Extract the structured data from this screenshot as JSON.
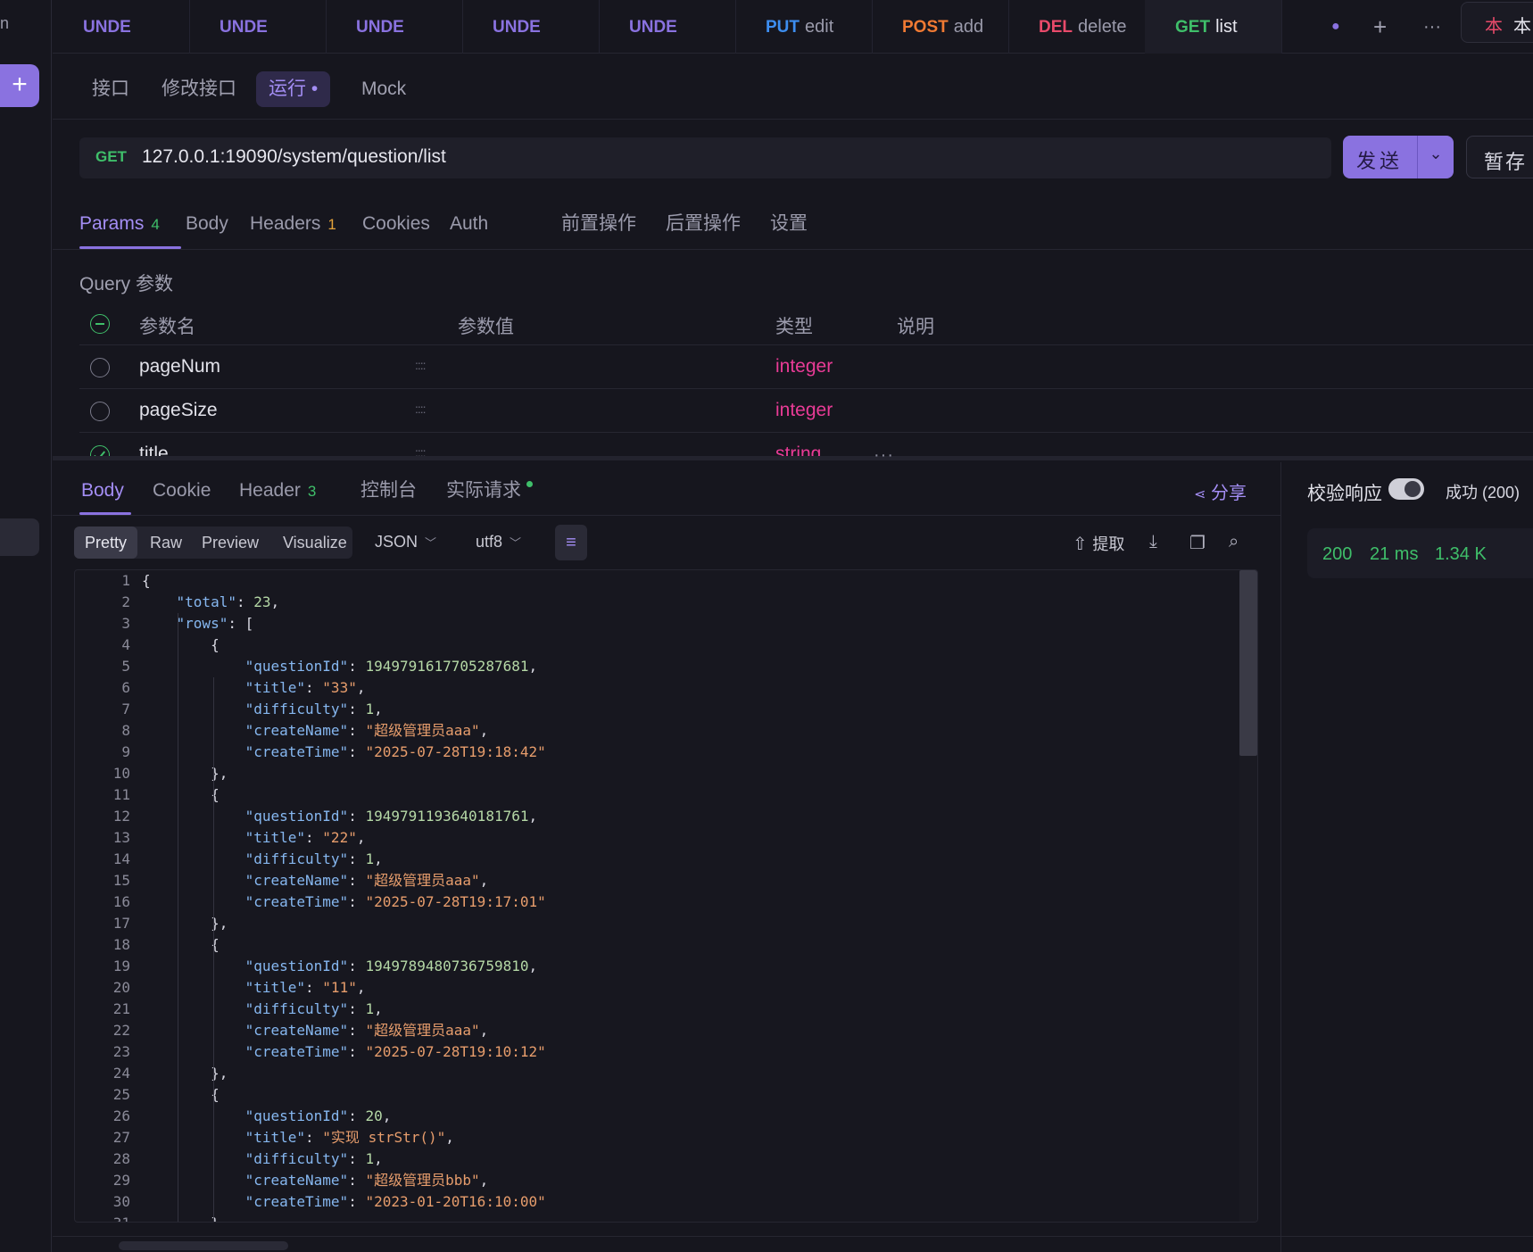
{
  "sidebar": {
    "stub_text": "n",
    "plus_label": "+"
  },
  "tabs": [
    {
      "method": "UNDE",
      "name": "",
      "color": "#8a72e0"
    },
    {
      "method": "UNDE",
      "name": "",
      "color": "#8a72e0"
    },
    {
      "method": "UNDE",
      "name": "",
      "color": "#8a72e0"
    },
    {
      "method": "UNDE",
      "name": "",
      "color": "#8a72e0"
    },
    {
      "method": "UNDE",
      "name": "",
      "color": "#8a72e0"
    },
    {
      "method": "PUT",
      "name": "edit",
      "color": "#3d8ef0"
    },
    {
      "method": "POST",
      "name": "add",
      "color": "#f07a33"
    },
    {
      "method": "DEL",
      "name": "delete",
      "color": "#e84a6a"
    },
    {
      "method": "GET",
      "name": "list",
      "color": "#3fbf6a",
      "active": true
    }
  ],
  "tabbar": {
    "dot": "●",
    "new_tab": "+",
    "more": "···"
  },
  "env": {
    "label1": "本",
    "label2": "本"
  },
  "subtabs": [
    "接口",
    "修改接口",
    "运行",
    "Mock"
  ],
  "subtab_active_suffix": "•",
  "request": {
    "method": "GET",
    "url": "127.0.0.1:19090/system/question/list",
    "send_label": "发送",
    "dropdown_icon": "⌄",
    "save_label": "暂存"
  },
  "request_tabs": [
    {
      "label": "Params",
      "count": "4",
      "count_color": "g"
    },
    {
      "label": "Body"
    },
    {
      "label": "Headers",
      "count": "1",
      "count_color": "o"
    },
    {
      "label": "Cookies"
    },
    {
      "label": "Auth"
    },
    {
      "label": "前置操作"
    },
    {
      "label": "后置操作"
    },
    {
      "label": "设置"
    }
  ],
  "query_label": "Query 参数",
  "params": {
    "headers": {
      "name": "参数名",
      "value": "参数值",
      "type": "类型",
      "desc": "说明"
    },
    "rows": [
      {
        "name": "pageNum",
        "type": "integer",
        "checked": false
      },
      {
        "name": "pageSize",
        "type": "integer",
        "checked": false
      },
      {
        "name": "title",
        "type": "string",
        "checked": true
      }
    ]
  },
  "splitter_dots": "···",
  "response_tabs": [
    {
      "label": "Body"
    },
    {
      "label": "Cookie"
    },
    {
      "label": "Header",
      "count": "3"
    },
    {
      "label": "控制台"
    },
    {
      "label": "实际请求",
      "dot": true
    }
  ],
  "share_label": "分享",
  "validate_label": "校验响应",
  "success_label": "成功 (200)",
  "stats": {
    "status": "200",
    "time": "21 ms",
    "size": "1.34 K"
  },
  "view_modes": [
    "Pretty",
    "Raw",
    "Preview",
    "Visualize"
  ],
  "format": "JSON",
  "encoding": "utf8",
  "extract_label": "提取",
  "code_lines": [
    [
      [
        "p",
        "{"
      ]
    ],
    [
      [
        "p",
        "    "
      ],
      [
        "k",
        "\"total\""
      ],
      [
        "p",
        ": "
      ],
      [
        "num",
        "23"
      ],
      [
        "p",
        ","
      ]
    ],
    [
      [
        "p",
        "    "
      ],
      [
        "k",
        "\"rows\""
      ],
      [
        "p",
        ": ["
      ]
    ],
    [
      [
        "p",
        "        {"
      ]
    ],
    [
      [
        "p",
        "            "
      ],
      [
        "k",
        "\"questionId\""
      ],
      [
        "p",
        ": "
      ],
      [
        "num",
        "1949791617705287681"
      ],
      [
        "p",
        ","
      ]
    ],
    [
      [
        "p",
        "            "
      ],
      [
        "k",
        "\"title\""
      ],
      [
        "p",
        ": "
      ],
      [
        "s",
        "\"33\""
      ],
      [
        "p",
        ","
      ]
    ],
    [
      [
        "p",
        "            "
      ],
      [
        "k",
        "\"difficulty\""
      ],
      [
        "p",
        ": "
      ],
      [
        "num",
        "1"
      ],
      [
        "p",
        ","
      ]
    ],
    [
      [
        "p",
        "            "
      ],
      [
        "k",
        "\"createName\""
      ],
      [
        "p",
        ": "
      ],
      [
        "s",
        "\"超级管理员aaa\""
      ],
      [
        "p",
        ","
      ]
    ],
    [
      [
        "p",
        "            "
      ],
      [
        "k",
        "\"createTime\""
      ],
      [
        "p",
        ": "
      ],
      [
        "s",
        "\"2025-07-28T19:18:42\""
      ]
    ],
    [
      [
        "p",
        "        },"
      ]
    ],
    [
      [
        "p",
        "        {"
      ]
    ],
    [
      [
        "p",
        "            "
      ],
      [
        "k",
        "\"questionId\""
      ],
      [
        "p",
        ": "
      ],
      [
        "num",
        "1949791193640181761"
      ],
      [
        "p",
        ","
      ]
    ],
    [
      [
        "p",
        "            "
      ],
      [
        "k",
        "\"title\""
      ],
      [
        "p",
        ": "
      ],
      [
        "s",
        "\"22\""
      ],
      [
        "p",
        ","
      ]
    ],
    [
      [
        "p",
        "            "
      ],
      [
        "k",
        "\"difficulty\""
      ],
      [
        "p",
        ": "
      ],
      [
        "num",
        "1"
      ],
      [
        "p",
        ","
      ]
    ],
    [
      [
        "p",
        "            "
      ],
      [
        "k",
        "\"createName\""
      ],
      [
        "p",
        ": "
      ],
      [
        "s",
        "\"超级管理员aaa\""
      ],
      [
        "p",
        ","
      ]
    ],
    [
      [
        "p",
        "            "
      ],
      [
        "k",
        "\"createTime\""
      ],
      [
        "p",
        ": "
      ],
      [
        "s",
        "\"2025-07-28T19:17:01\""
      ]
    ],
    [
      [
        "p",
        "        },"
      ]
    ],
    [
      [
        "p",
        "        {"
      ]
    ],
    [
      [
        "p",
        "            "
      ],
      [
        "k",
        "\"questionId\""
      ],
      [
        "p",
        ": "
      ],
      [
        "num",
        "1949789480736759810"
      ],
      [
        "p",
        ","
      ]
    ],
    [
      [
        "p",
        "            "
      ],
      [
        "k",
        "\"title\""
      ],
      [
        "p",
        ": "
      ],
      [
        "s",
        "\"11\""
      ],
      [
        "p",
        ","
      ]
    ],
    [
      [
        "p",
        "            "
      ],
      [
        "k",
        "\"difficulty\""
      ],
      [
        "p",
        ": "
      ],
      [
        "num",
        "1"
      ],
      [
        "p",
        ","
      ]
    ],
    [
      [
        "p",
        "            "
      ],
      [
        "k",
        "\"createName\""
      ],
      [
        "p",
        ": "
      ],
      [
        "s",
        "\"超级管理员aaa\""
      ],
      [
        "p",
        ","
      ]
    ],
    [
      [
        "p",
        "            "
      ],
      [
        "k",
        "\"createTime\""
      ],
      [
        "p",
        ": "
      ],
      [
        "s",
        "\"2025-07-28T19:10:12\""
      ]
    ],
    [
      [
        "p",
        "        },"
      ]
    ],
    [
      [
        "p",
        "        {"
      ]
    ],
    [
      [
        "p",
        "            "
      ],
      [
        "k",
        "\"questionId\""
      ],
      [
        "p",
        ": "
      ],
      [
        "num",
        "20"
      ],
      [
        "p",
        ","
      ]
    ],
    [
      [
        "p",
        "            "
      ],
      [
        "k",
        "\"title\""
      ],
      [
        "p",
        ": "
      ],
      [
        "s",
        "\"实现 strStr()\""
      ],
      [
        "p",
        ","
      ]
    ],
    [
      [
        "p",
        "            "
      ],
      [
        "k",
        "\"difficulty\""
      ],
      [
        "p",
        ": "
      ],
      [
        "num",
        "1"
      ],
      [
        "p",
        ","
      ]
    ],
    [
      [
        "p",
        "            "
      ],
      [
        "k",
        "\"createName\""
      ],
      [
        "p",
        ": "
      ],
      [
        "s",
        "\"超级管理员bbb\""
      ],
      [
        "p",
        ","
      ]
    ],
    [
      [
        "p",
        "            "
      ],
      [
        "k",
        "\"createTime\""
      ],
      [
        "p",
        ": "
      ],
      [
        "s",
        "\"2023-01-20T16:10:00\""
      ]
    ],
    [
      [
        "p",
        "        },"
      ]
    ]
  ],
  "colors": {
    "accent": "#8a72e0",
    "success": "#3fbf6a",
    "type": "#e93b96"
  }
}
